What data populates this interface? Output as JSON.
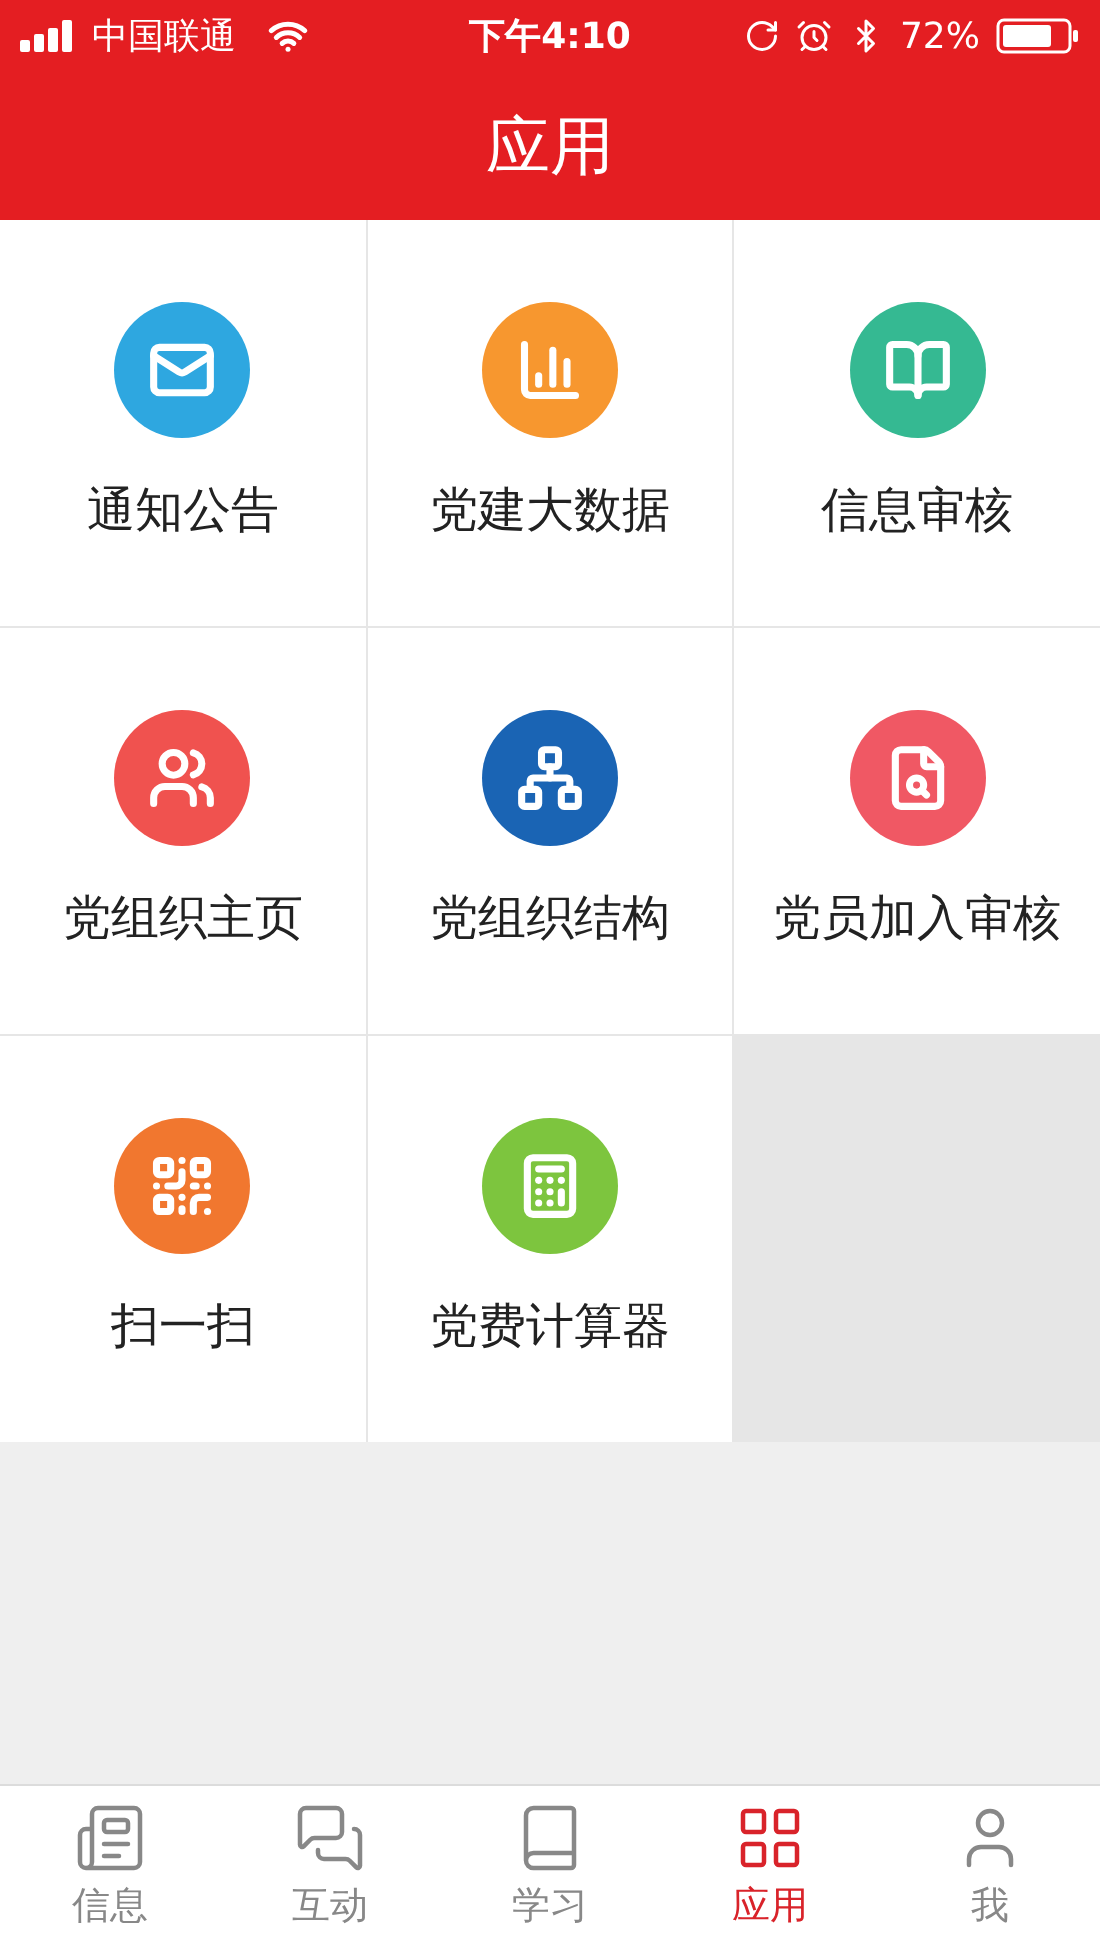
{
  "status_bar": {
    "carrier": "中国联通",
    "time": "下午4:10",
    "battery": "72%"
  },
  "header": {
    "title": "应用"
  },
  "apps": [
    {
      "label": "通知公告",
      "color": "#2ea7e0"
    },
    {
      "label": "党建大数据",
      "color": "#f7972f"
    },
    {
      "label": "信息审核",
      "color": "#35b992"
    },
    {
      "label": "党组织主页",
      "color": "#f0524f"
    },
    {
      "label": "党组织结构",
      "color": "#1a64b4"
    },
    {
      "label": "党员加入审核",
      "color": "#f05864"
    },
    {
      "label": "扫一扫",
      "color": "#f1772f"
    },
    {
      "label": "党费计算器",
      "color": "#7dc53e"
    }
  ],
  "tab_bar": [
    {
      "label": "信息",
      "selected": false
    },
    {
      "label": "互动",
      "selected": false
    },
    {
      "label": "学习",
      "selected": false
    },
    {
      "label": "应用",
      "selected": true
    },
    {
      "label": "我",
      "selected": false
    }
  ]
}
